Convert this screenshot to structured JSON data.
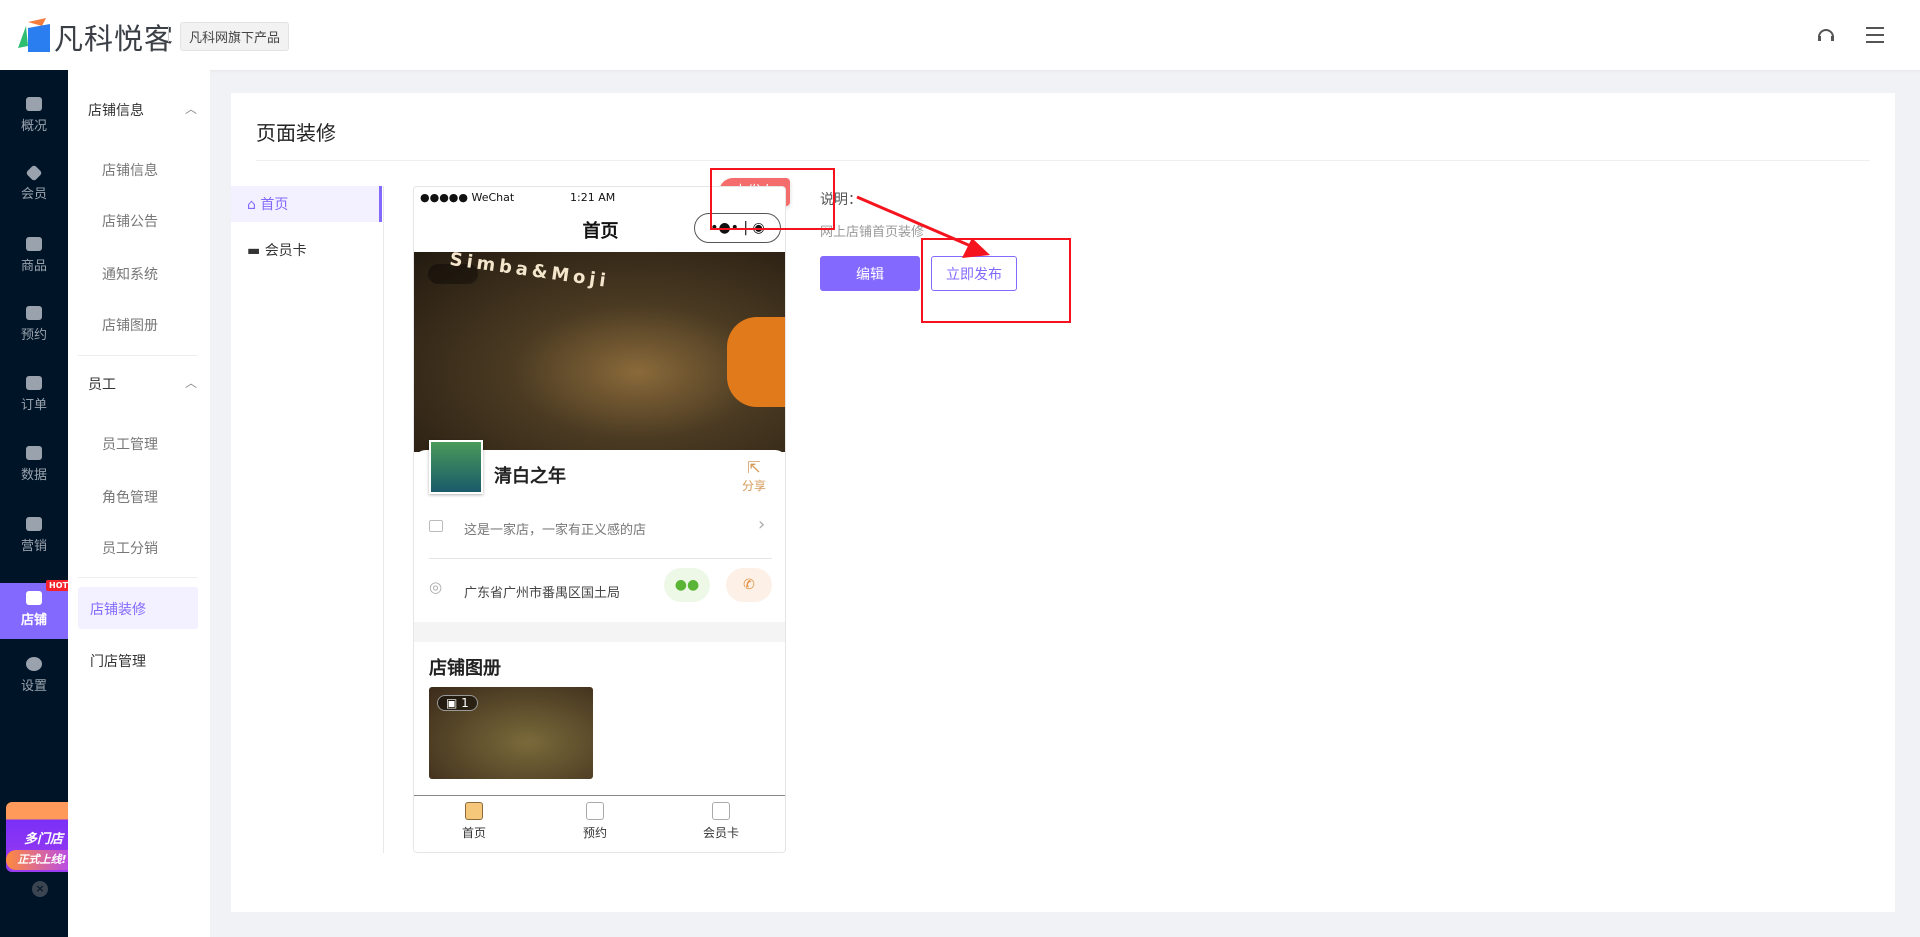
{
  "header": {
    "brand": "凡科悦客",
    "badge": "凡科网旗下产品",
    "icons": [
      "headset-icon",
      "menu-icon"
    ]
  },
  "nav": {
    "items": [
      {
        "label": "概况",
        "icon": "monitor-icon"
      },
      {
        "label": "会员",
        "icon": "diamond-icon"
      },
      {
        "label": "商品",
        "icon": "box-icon"
      },
      {
        "label": "预约",
        "icon": "calendar-clock-icon"
      },
      {
        "label": "订单",
        "icon": "clipboard-icon"
      },
      {
        "label": "数据",
        "icon": "bar-chart-icon"
      },
      {
        "label": "营销",
        "icon": "megaphone-icon"
      },
      {
        "label": "店铺",
        "icon": "store-icon"
      },
      {
        "label": "设置",
        "icon": "gear-icon"
      }
    ],
    "hot": "HOT",
    "active": "店铺",
    "promo": {
      "line1": "多门店",
      "line2": "正式上线!"
    }
  },
  "submenu": {
    "group1": {
      "title": "店铺信息",
      "items": [
        "店铺信息",
        "店铺公告",
        "通知系统",
        "店铺图册"
      ]
    },
    "group2": {
      "title": "员工",
      "items": [
        "员工管理",
        "角色管理",
        "员工分销"
      ]
    },
    "active": "店铺装修",
    "other": "门店管理"
  },
  "main": {
    "title": "页面装修",
    "pages": [
      "首页",
      "会员卡"
    ],
    "phone": {
      "carrier": "●●●●● WeChat",
      "time": "1:21 AM",
      "nav_title": "首页",
      "capsule": "•●•  |  ◉",
      "banner_sign": "Simba&Moji",
      "store_name": "清白之年",
      "share": "分享",
      "desc": "这是一家店，一家有正义感的店",
      "address": "广东省广州市番禺区国土局",
      "album_title": "店铺图册",
      "album_count": "1",
      "tabs": [
        "首页",
        "预约",
        "会员卡"
      ]
    },
    "status": "未发布",
    "explain_label": "说明：",
    "explain_text": "网上店铺首页装修",
    "edit": "编辑",
    "publish": "立即发布"
  },
  "colors": {
    "accent": "#8469ff",
    "nav_bg": "#001428",
    "unpublished": "#f56c6c",
    "annotation": "#f5141e"
  }
}
